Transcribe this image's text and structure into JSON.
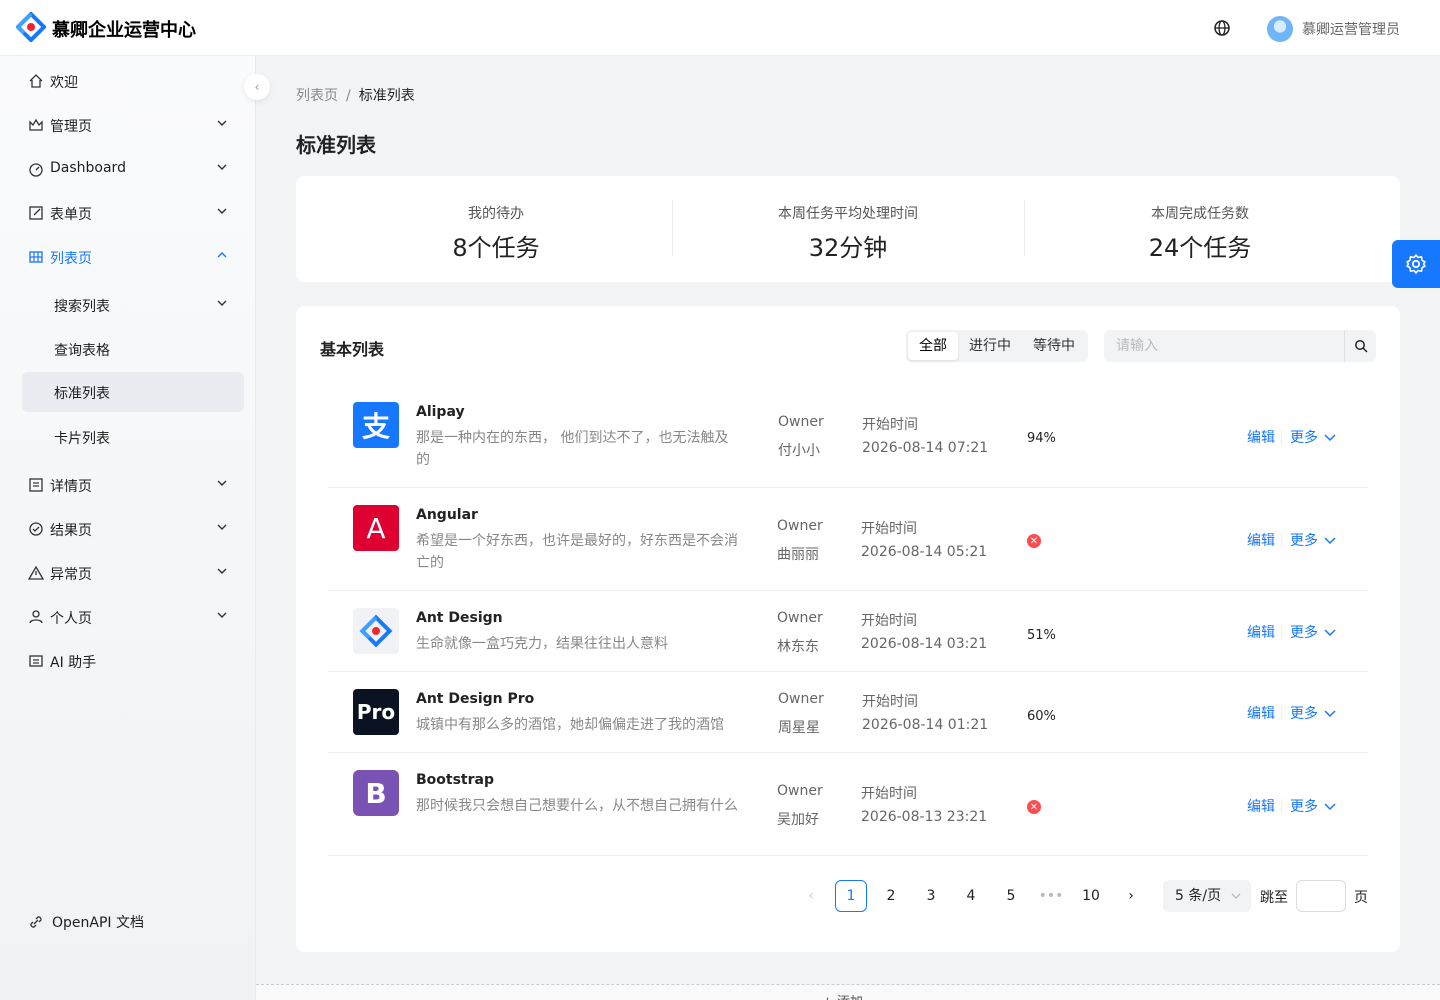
{
  "header": {
    "app_title": "慕卿企业运营中心",
    "user_name": "慕卿运营管理员",
    "icons": [
      "logo-icon",
      "globe-icon",
      "avatar"
    ]
  },
  "sidebar": {
    "items": [
      {
        "label": "欢迎",
        "icon": "home-icon"
      },
      {
        "label": "管理页",
        "icon": "crown-icon"
      },
      {
        "label": "Dashboard",
        "icon": "dashboard-icon"
      },
      {
        "label": "表单页",
        "icon": "form-icon"
      },
      {
        "label": "列表页",
        "icon": "table-icon"
      },
      {
        "label": "搜索列表"
      },
      {
        "label": "查询表格"
      },
      {
        "label": "标准列表"
      },
      {
        "label": "卡片列表"
      },
      {
        "label": "详情页",
        "icon": "profile-icon"
      },
      {
        "label": "结果页",
        "icon": "check-circle-icon"
      },
      {
        "label": "异常页",
        "icon": "warning-icon"
      },
      {
        "label": "个人页",
        "icon": "user-icon"
      },
      {
        "label": "AI 助手",
        "icon": "robot-icon"
      }
    ],
    "footer_link": "OpenAPI 文档"
  },
  "breadcrumb": {
    "parent": "列表页",
    "separator": "/",
    "current": "标准列表"
  },
  "page_title": "标准列表",
  "stats": [
    {
      "label": "我的待办",
      "value": "8个任务"
    },
    {
      "label": "本周任务平均处理时间",
      "value": "32分钟"
    },
    {
      "label": "本周完成任务数",
      "value": "24个任务"
    }
  ],
  "list": {
    "title": "基本列表",
    "filters": [
      "全部",
      "进行中",
      "等待中"
    ],
    "active_filter": "全部",
    "search_placeholder": "请输入",
    "owner_label": "Owner",
    "time_label": "开始时间",
    "edit_label": "编辑",
    "more_label": "更多",
    "rows": [
      {
        "name": "Alipay",
        "desc": "那是一种内在的东西， 他们到达不了，也无法触及的",
        "owner": "付小小",
        "time": "2026-08-14 07:21",
        "progress": "94%",
        "status": "normal",
        "logo_text": "支",
        "logo_color": "#1677ff"
      },
      {
        "name": "Angular",
        "desc": "希望是一个好东西，也许是最好的，好东西是不会消亡的",
        "owner": "曲丽丽",
        "time": "2026-08-14 05:21",
        "progress": "",
        "status": "exception",
        "logo_text": "A",
        "logo_color": "#dd0031"
      },
      {
        "name": "Ant Design",
        "desc": "生命就像一盒巧克力，结果往往出人意料",
        "owner": "林东东",
        "time": "2026-08-14 03:21",
        "progress": "51%",
        "status": "normal",
        "logo_text": "",
        "logo_color": "#f0f2f5"
      },
      {
        "name": "Ant Design Pro",
        "desc": "城镇中有那么多的酒馆，她却偏偏走进了我的酒馆",
        "owner": "周星星",
        "time": "2026-08-14 01:21",
        "progress": "60%",
        "status": "normal",
        "logo_text": "Pro",
        "logo_color": "#0b1221"
      },
      {
        "name": "Bootstrap",
        "desc": "那时候我只会想自己想要什么，从不想自己拥有什么",
        "owner": "吴加好",
        "time": "2026-08-13 23:21",
        "progress": "",
        "status": "exception",
        "logo_text": "B",
        "logo_color": "#7952b3"
      }
    ]
  },
  "pagination": {
    "pages": [
      "1",
      "2",
      "3",
      "4",
      "5",
      "•••",
      "10"
    ],
    "current": "1",
    "page_size": "5 条/页",
    "jump_label": "跳至",
    "page_unit": "页"
  },
  "add_button": "+ 添加",
  "colors": {
    "primary": "#1677ff",
    "error": "#ff4d4f"
  }
}
